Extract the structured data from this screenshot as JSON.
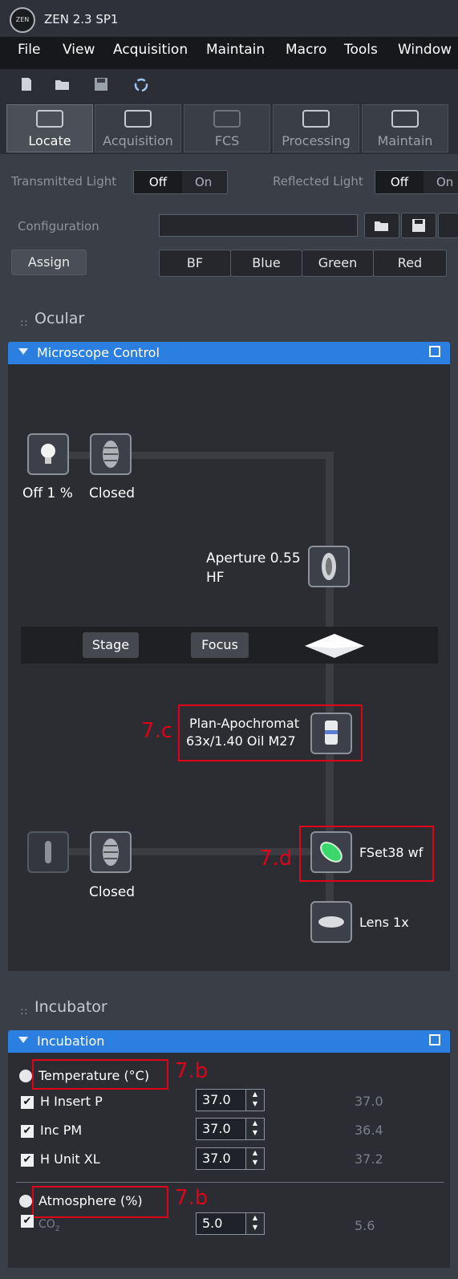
{
  "window": {
    "logo_text": "ZEN",
    "title": "ZEN 2.3 SP1"
  },
  "menu": [
    "File",
    "View",
    "Acquisition",
    "Maintain",
    "Macro",
    "Tools",
    "Window"
  ],
  "toolbar_icons": [
    "new-file-icon",
    "open-folder-icon",
    "save-icon",
    "refresh-icon"
  ],
  "tabs": [
    {
      "label": "Locate",
      "active": true
    },
    {
      "label": "Acquisition",
      "active": false
    },
    {
      "label": "FCS",
      "active": false
    },
    {
      "label": "Processing",
      "active": false
    },
    {
      "label": "Maintain",
      "active": false
    }
  ],
  "light": {
    "transmitted_label": "Transmitted Light",
    "reflected_label": "Reflected Light",
    "off": "Off",
    "on": "On",
    "on_truncated": "On"
  },
  "configuration": {
    "label": "Configuration",
    "value": "",
    "assign": "Assign"
  },
  "channels": [
    "BF",
    "Blue",
    "Green",
    "Red"
  ],
  "ocular": {
    "title": "Ocular",
    "panel_title": "Microscope Control",
    "lamp_status": "Off  1 %",
    "shutter_top": "Closed",
    "aperture_line1": "Aperture 0.55",
    "aperture_line2": "HF",
    "stage": "Stage",
    "focus": "Focus",
    "objective_line1": "Plan-Apochromat",
    "objective_line2": "63x/1.40 Oil M27",
    "filter": "FSet38 wf",
    "shutter_bottom": "Closed",
    "lens": "Lens 1x",
    "annot_c": "7.c",
    "annot_d": "7.d"
  },
  "incubator": {
    "title": "Incubator",
    "panel_title": "Incubation",
    "temperature_title": "Temperature (°C)",
    "atmosphere_title": "Atmosphere (%)",
    "annot_b": "7.b",
    "rows": [
      {
        "label": "H Insert P",
        "setpoint": "37.0",
        "actual": "37.0"
      },
      {
        "label": "Inc PM",
        "setpoint": "37.0",
        "actual": "36.4"
      },
      {
        "label": "H Unit XL",
        "setpoint": "37.0",
        "actual": "37.2"
      }
    ],
    "co2": {
      "label": "CO",
      "sub": "2",
      "setpoint": "5.0",
      "actual": "5.6"
    }
  },
  "colors": {
    "accent_blue": "#2b7fe0",
    "annotation_red": "#e0001a",
    "filter_green": "#3ad86a"
  }
}
